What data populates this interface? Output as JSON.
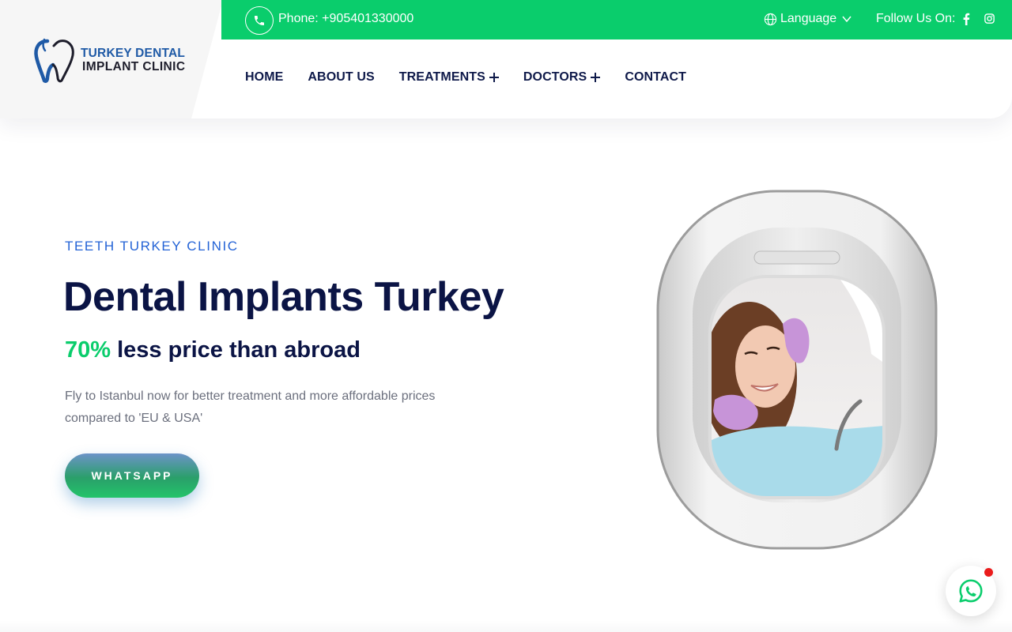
{
  "brand": {
    "name_line1": "TURKEY DENTAL",
    "name_line2": "IMPLANT CLINIC",
    "colors": {
      "primary_green": "#0acd6c",
      "navy": "#0b1445",
      "blue": "#2463d6",
      "logo_blue": "#1f5aa6"
    }
  },
  "topbar": {
    "phone_label": "Phone:",
    "phone_number": "+905401330000",
    "language_label": "Language",
    "follow_label": "Follow Us On:",
    "icons": [
      "phone-icon",
      "globe-icon",
      "chevron-down-icon",
      "facebook-icon",
      "instagram-icon"
    ]
  },
  "nav": {
    "items": [
      {
        "label": "HOME",
        "has_submenu": false
      },
      {
        "label": "ABOUT US",
        "has_submenu": false
      },
      {
        "label": "TREATMENTS",
        "has_submenu": true
      },
      {
        "label": "DOCTORS",
        "has_submenu": true
      },
      {
        "label": "CONTACT",
        "has_submenu": false
      }
    ]
  },
  "hero": {
    "eyebrow": "TEETH TURKEY CLINIC",
    "title": "Dental Implants Turkey",
    "subtitle_accent": "70%",
    "subtitle_rest": " less price than abroad",
    "description": "Fly to Istanbul now for better treatment and more affordable prices compared to 'EU & USA'",
    "cta_label": "WHATSAPP",
    "image": "airplane-window-with-dental-patient"
  },
  "chat_widget": {
    "icon": "whatsapp-icon",
    "has_notification": true
  }
}
